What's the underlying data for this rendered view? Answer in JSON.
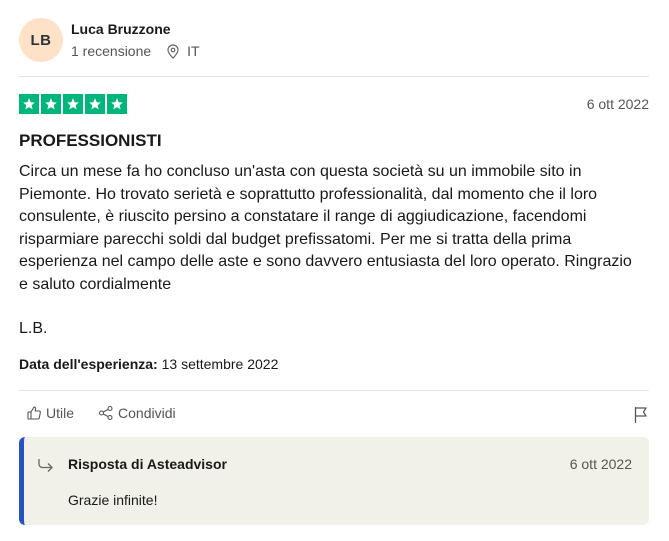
{
  "consumer": {
    "initials": "LB",
    "name": "Luca Bruzzone",
    "review_count": "1 recensione",
    "location": "IT",
    "avatar_color": "#fde2c8"
  },
  "review": {
    "rating": 5,
    "star_color": "#00b67a",
    "date": "6 ott 2022",
    "title": "PROFESSIONISTI",
    "body": "Circa un mese fa ho concluso un'asta con questa società su un immobile sito in Piemonte. Ho trovato serietà e soprattutto professionalità, dal momento che il loro consulente, è riuscito persino a constatare il range di aggiudicazione, facendomi risparmiare parecchi soldi dal budget prefissatomi. Per me si tratta della prima esperienza nel campo delle aste e sono davvero entusiasta del loro operato. Ringrazio e saluto cordialmente",
    "signature": "L.B.",
    "experience_label": "Data dell'esperienza:",
    "experience_date": "13 settembre 2022"
  },
  "actions": {
    "useful_label": "Utile",
    "share_label": "Condividi",
    "useful_icon": "thumbs-up-icon",
    "share_icon": "share-icon",
    "flag_icon": "flag-icon"
  },
  "reply": {
    "title": "Risposta di Asteadvisor",
    "date": "6 ott 2022",
    "text": "Grazie infinite!",
    "accent_color": "#2a52be",
    "background_color": "#f1f1e8"
  }
}
